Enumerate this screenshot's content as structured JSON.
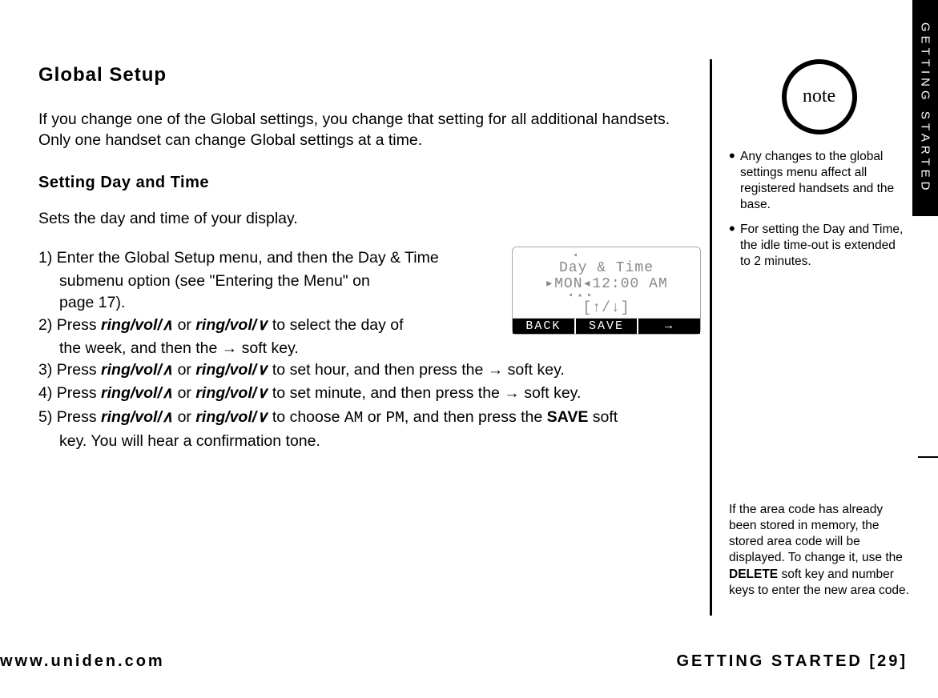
{
  "tab": "GETTING STARTED",
  "main": {
    "title": "Global Setup",
    "intro": "If you change one of the Global settings, you change that setting for all additional handsets. Only one handset can change Global settings at a time.",
    "subhead": "Setting Day and Time",
    "para": "Sets the day and time of your display.",
    "s1a": "1) Enter the Global Setup menu, and then the Day & Time",
    "s1b": "submenu option (see \"Entering the Menu\" on",
    "s1c": "page 17).",
    "s2a": "2) Press ",
    "ringup": "ring/vol/∧",
    "or": " or ",
    "ringdn": "ring/vol/∨",
    "s2b": " to select the day of",
    "s2c": "the week, and then the → soft key.",
    "s3a": "3) Press ",
    "s3b": " to set hour, and then press the → soft key.",
    "s4a": "4) Press ",
    "s4b": " to set minute, and then press the → soft key.",
    "s5a": "5) Press ",
    "s5b": " to choose ",
    "am": "AM",
    "or2": " or ",
    "pm": "PM",
    "s5c": ", and then press the ",
    "save": "SAVE",
    "s5d": " soft",
    "s5e": "key. You will hear a confirmation tone."
  },
  "lcd": {
    "l1": " Day & Time",
    "l2": "▸MON◂12:00 AM",
    "l3": "[↑/↓]",
    "k1": "BACK",
    "k2": "SAVE",
    "k3": "→"
  },
  "side": {
    "note_label": "note",
    "b1": "Any changes to the global settings menu affect all registered handsets and the base.",
    "b2": "For setting the Day and Time, the idle time-out is extended to 2 minutes.",
    "n2a": "If the area code has already been stored in memory, the stored area code will be displayed. To change it, use the ",
    "n2b": "DELETE",
    "n2c": " soft key and number keys to enter the new area code."
  },
  "footer": {
    "url": "www.uniden.com",
    "right": "GETTING STARTED [29]"
  }
}
